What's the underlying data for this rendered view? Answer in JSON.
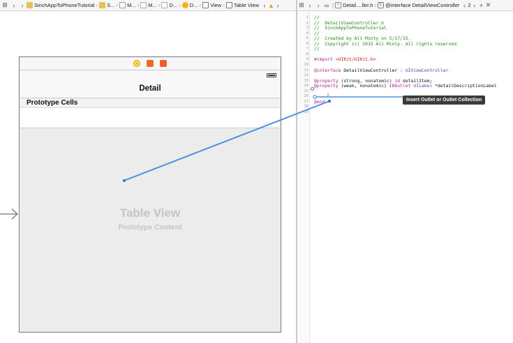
{
  "left_jumpbar": {
    "crumbs": [
      {
        "label": "SinchAppToPhoneTutorial",
        "icon": "folder-icon"
      },
      {
        "label": "S...",
        "icon": "folder-icon"
      },
      {
        "label": "M...",
        "icon": "file-icon"
      },
      {
        "label": "M...",
        "icon": "storyboard-icon"
      },
      {
        "label": "D...",
        "icon": "scene-icon"
      },
      {
        "label": "D...",
        "icon": "view-controller-icon"
      },
      {
        "label": "View",
        "icon": "view-icon"
      },
      {
        "label": "Table View",
        "icon": "table-view-icon"
      }
    ]
  },
  "right_jumpbar": {
    "file_label": "Detail....ller.h",
    "symbol_label": "@interface DetailViewController",
    "counter": "2"
  },
  "storyboard": {
    "nav_title": "Detail",
    "prototype_header": "Prototype Cells",
    "table_view_title": "Table View",
    "table_view_subtitle": "Prototype Content"
  },
  "editor": {
    "lines": [
      {
        "n": "1",
        "segments": [
          {
            "c": "cm",
            "t": "//"
          }
        ]
      },
      {
        "n": "2",
        "segments": [
          {
            "c": "cm",
            "t": "//  DetailViewController.h"
          }
        ]
      },
      {
        "n": "3",
        "segments": [
          {
            "c": "cm",
            "t": "//  SinchAppToPhoneTutorial"
          }
        ]
      },
      {
        "n": "4",
        "segments": [
          {
            "c": "cm",
            "t": "//"
          }
        ]
      },
      {
        "n": "5",
        "segments": [
          {
            "c": "cm",
            "t": "//  Created by Ali Minty on 5/17/15."
          }
        ]
      },
      {
        "n": "6",
        "segments": [
          {
            "c": "cm",
            "t": "//  Copyright (c) 2015 Ali Minty. All rights reserved."
          }
        ]
      },
      {
        "n": "7",
        "segments": [
          {
            "c": "cm",
            "t": "//"
          }
        ]
      },
      {
        "n": "8",
        "segments": []
      },
      {
        "n": "9",
        "segments": [
          {
            "c": "kw",
            "t": "#import "
          },
          {
            "c": "str",
            "t": "<UIKit/UIKit.h>"
          }
        ]
      },
      {
        "n": "10",
        "segments": []
      },
      {
        "n": "11",
        "segments": [
          {
            "c": "kw",
            "t": "@interface "
          },
          {
            "c": "pl",
            "t": "DetailViewController : "
          },
          {
            "c": "tp",
            "t": "UIViewController"
          }
        ]
      },
      {
        "n": "12",
        "segments": []
      },
      {
        "n": "13",
        "segments": [
          {
            "c": "kw",
            "t": "@property "
          },
          {
            "c": "pl",
            "t": "(strong, nonatomic) "
          },
          {
            "c": "kw",
            "t": "id"
          },
          {
            "c": "pl",
            "t": " detailItem;"
          }
        ]
      },
      {
        "n": "14",
        "segments": [
          {
            "c": "kw",
            "t": "@property "
          },
          {
            "c": "pl",
            "t": "(weak, nonatomic) "
          },
          {
            "c": "kw",
            "t": "IBOutlet "
          },
          {
            "c": "tp",
            "t": "UILabel"
          },
          {
            "c": "pl",
            "t": " *detailDescriptionLabel"
          }
        ]
      },
      {
        "n": "15",
        "segments": []
      },
      {
        "n": "16",
        "segments": []
      },
      {
        "n": "17",
        "segments": [
          {
            "c": "kw",
            "t": "@end"
          }
        ]
      },
      {
        "n": "18",
        "segments": []
      },
      {
        "n": "19",
        "segments": []
      }
    ],
    "cursor_text": ";",
    "tooltip": "Insert Outlet or Outlet Collection"
  }
}
